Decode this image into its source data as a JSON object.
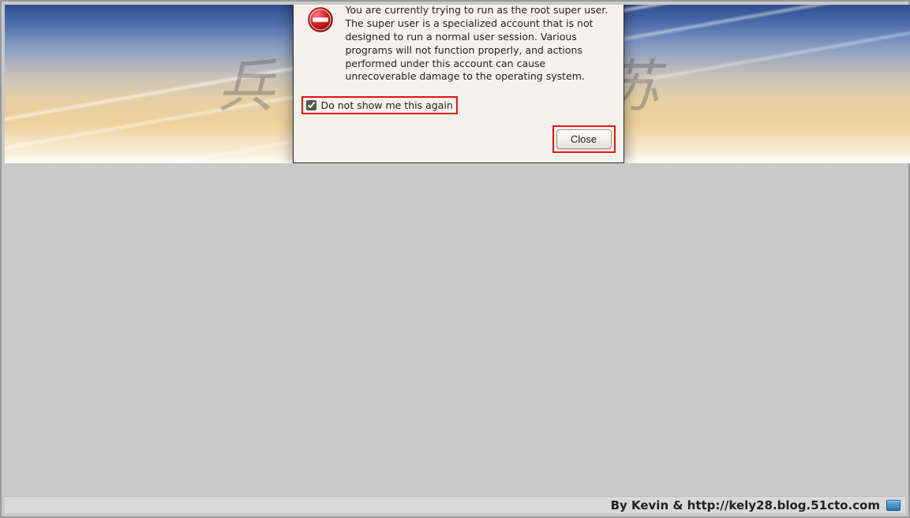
{
  "dialog": {
    "message": "You are currently trying to run as the root super user.  The super user is a specialized account that is not designed to run a normal user session.  Various programs will not function properly, and actions performed under this account can cause unrecoverable damage to the operating system.",
    "checkbox_label": "Do not show me this again",
    "checkbox_checked": true,
    "close_label": "Close",
    "titlebar_close_glyph": "×"
  },
  "watermark_text": "兵马俑友苏",
  "footer_credit": "By Kevin & http://kely28.blog.51cto.com",
  "colors": {
    "highlight": "#e11",
    "dialog_bg": "#f5f2ed",
    "titlebar_from": "#3b3b3b",
    "titlebar_to": "#141414"
  }
}
